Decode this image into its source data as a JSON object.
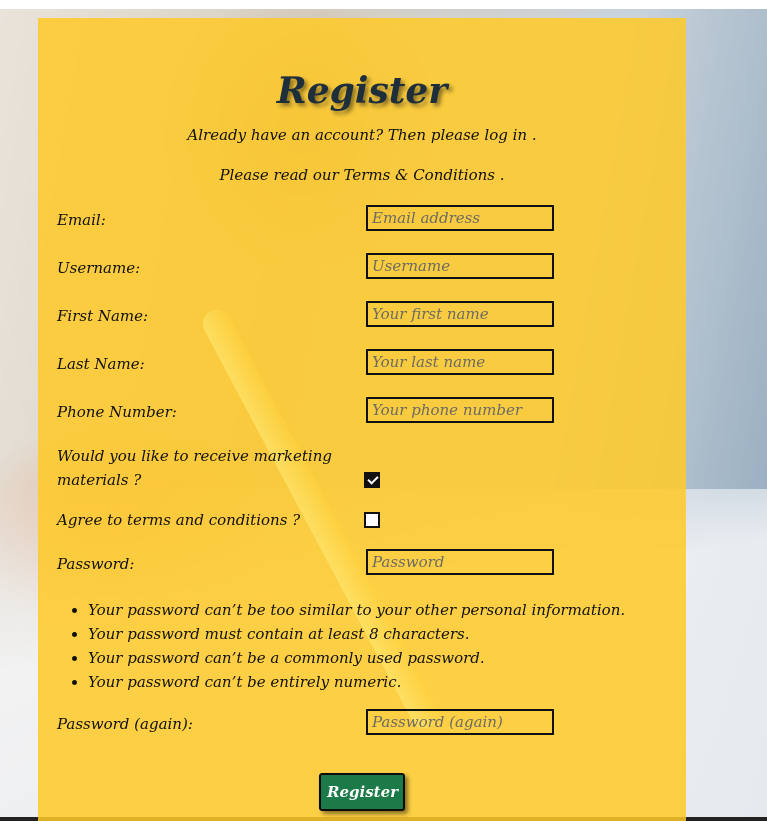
{
  "page": {
    "title": "Register",
    "account_prompt": "Already have an account? Then please log in .",
    "terms_prompt": "Please read our Terms & Conditions ."
  },
  "form": {
    "email": {
      "label": "Email:",
      "placeholder": "Email address",
      "value": ""
    },
    "username": {
      "label": "Username:",
      "placeholder": "Username",
      "value": ""
    },
    "first_name": {
      "label": "First Name:",
      "placeholder": "Your first name",
      "value": ""
    },
    "last_name": {
      "label": "Last Name:",
      "placeholder": "Your last name",
      "value": ""
    },
    "phone": {
      "label": "Phone Number:",
      "placeholder": "Your phone number",
      "value": ""
    },
    "marketing": {
      "label_line1": "Would you like to receive marketing",
      "label_line2": "materials ?",
      "checked": true
    },
    "terms": {
      "label": "Agree to terms and conditions ?",
      "checked": false
    },
    "password": {
      "label": "Password:",
      "placeholder": "Password",
      "value": ""
    },
    "password_rules": [
      "Your password can’t be too similar to your other personal information.",
      "Your password must contain at least 8 characters.",
      "Your password can’t be a commonly used password.",
      "Your password can’t be entirely numeric."
    ],
    "password_again": {
      "label": "Password (again):",
      "placeholder": "Password (again)",
      "value": ""
    },
    "submit_label": "Register"
  },
  "colors": {
    "panel": "#ffc928",
    "button": "#1b7a47",
    "text": "#111111"
  }
}
